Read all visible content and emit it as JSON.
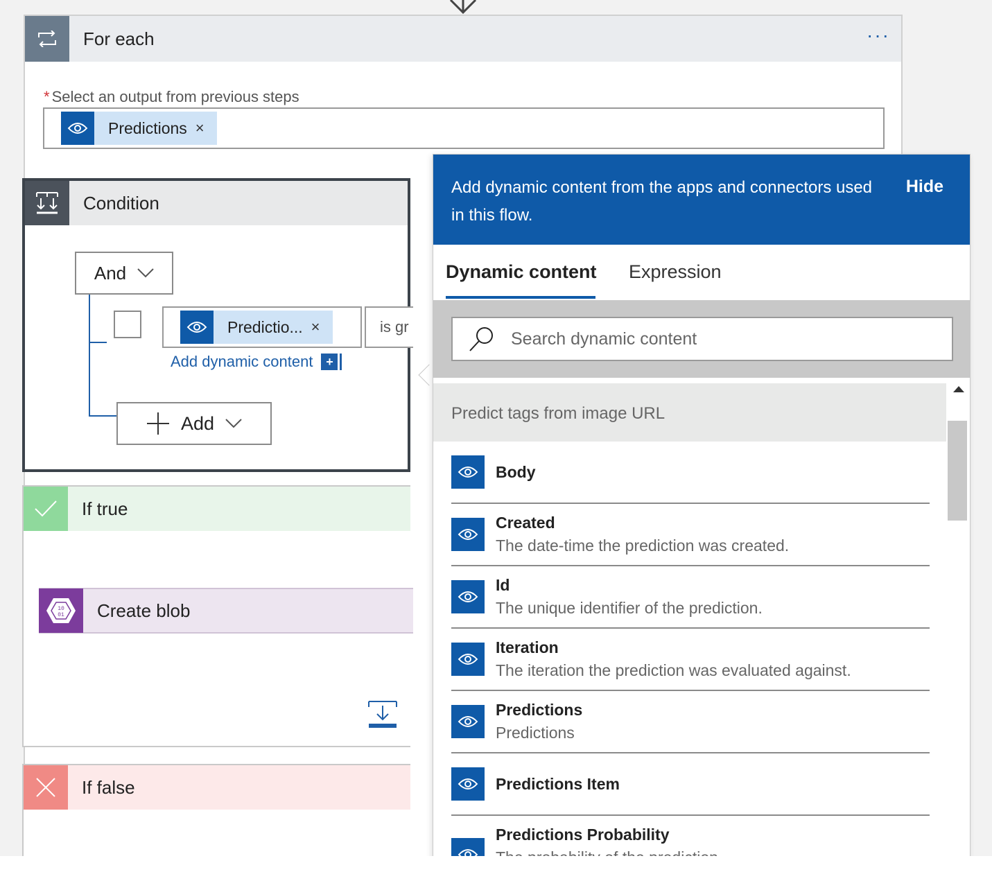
{
  "foreach": {
    "title": "For each",
    "more_label": "···",
    "required_label": "Select an output from previous steps",
    "required_star": "*",
    "token": {
      "label": "Predictions",
      "remove": "×"
    }
  },
  "condition": {
    "title": "Condition",
    "group_operator": "And",
    "row": {
      "token_label": "Predictio...",
      "token_remove": "×",
      "operator_value": "is gr"
    },
    "add_dynamic_label": "Add dynamic content",
    "add_dynamic_plus": "+",
    "add_button_label": "Add"
  },
  "if_true": {
    "title": "If true",
    "action_title": "Create blob"
  },
  "if_false": {
    "title": "If false"
  },
  "panel": {
    "message": "Add dynamic content from the apps and connectors used in this flow.",
    "hide_label": "Hide",
    "tabs": [
      {
        "label": "Dynamic content",
        "active": true
      },
      {
        "label": "Expression",
        "active": false
      }
    ],
    "search": {
      "placeholder": "Search dynamic content",
      "value": ""
    },
    "group_title": "Predict tags from image URL",
    "items": [
      {
        "name": "Body",
        "desc": ""
      },
      {
        "name": "Created",
        "desc": "The date-time the prediction was created."
      },
      {
        "name": "Id",
        "desc": "The unique identifier of the prediction."
      },
      {
        "name": "Iteration",
        "desc": "The iteration the prediction was evaluated against."
      },
      {
        "name": "Predictions",
        "desc": "Predictions"
      },
      {
        "name": "Predictions Item",
        "desc": ""
      },
      {
        "name": "Predictions Probability",
        "desc": "The probability of the prediction."
      }
    ]
  },
  "colors": {
    "accent_blue": "#0f5aa8",
    "condition_dark": "#3c434b",
    "true_green": "#8fd99c",
    "false_red": "#f08a85",
    "blob_purple": "#7c3c9c"
  }
}
